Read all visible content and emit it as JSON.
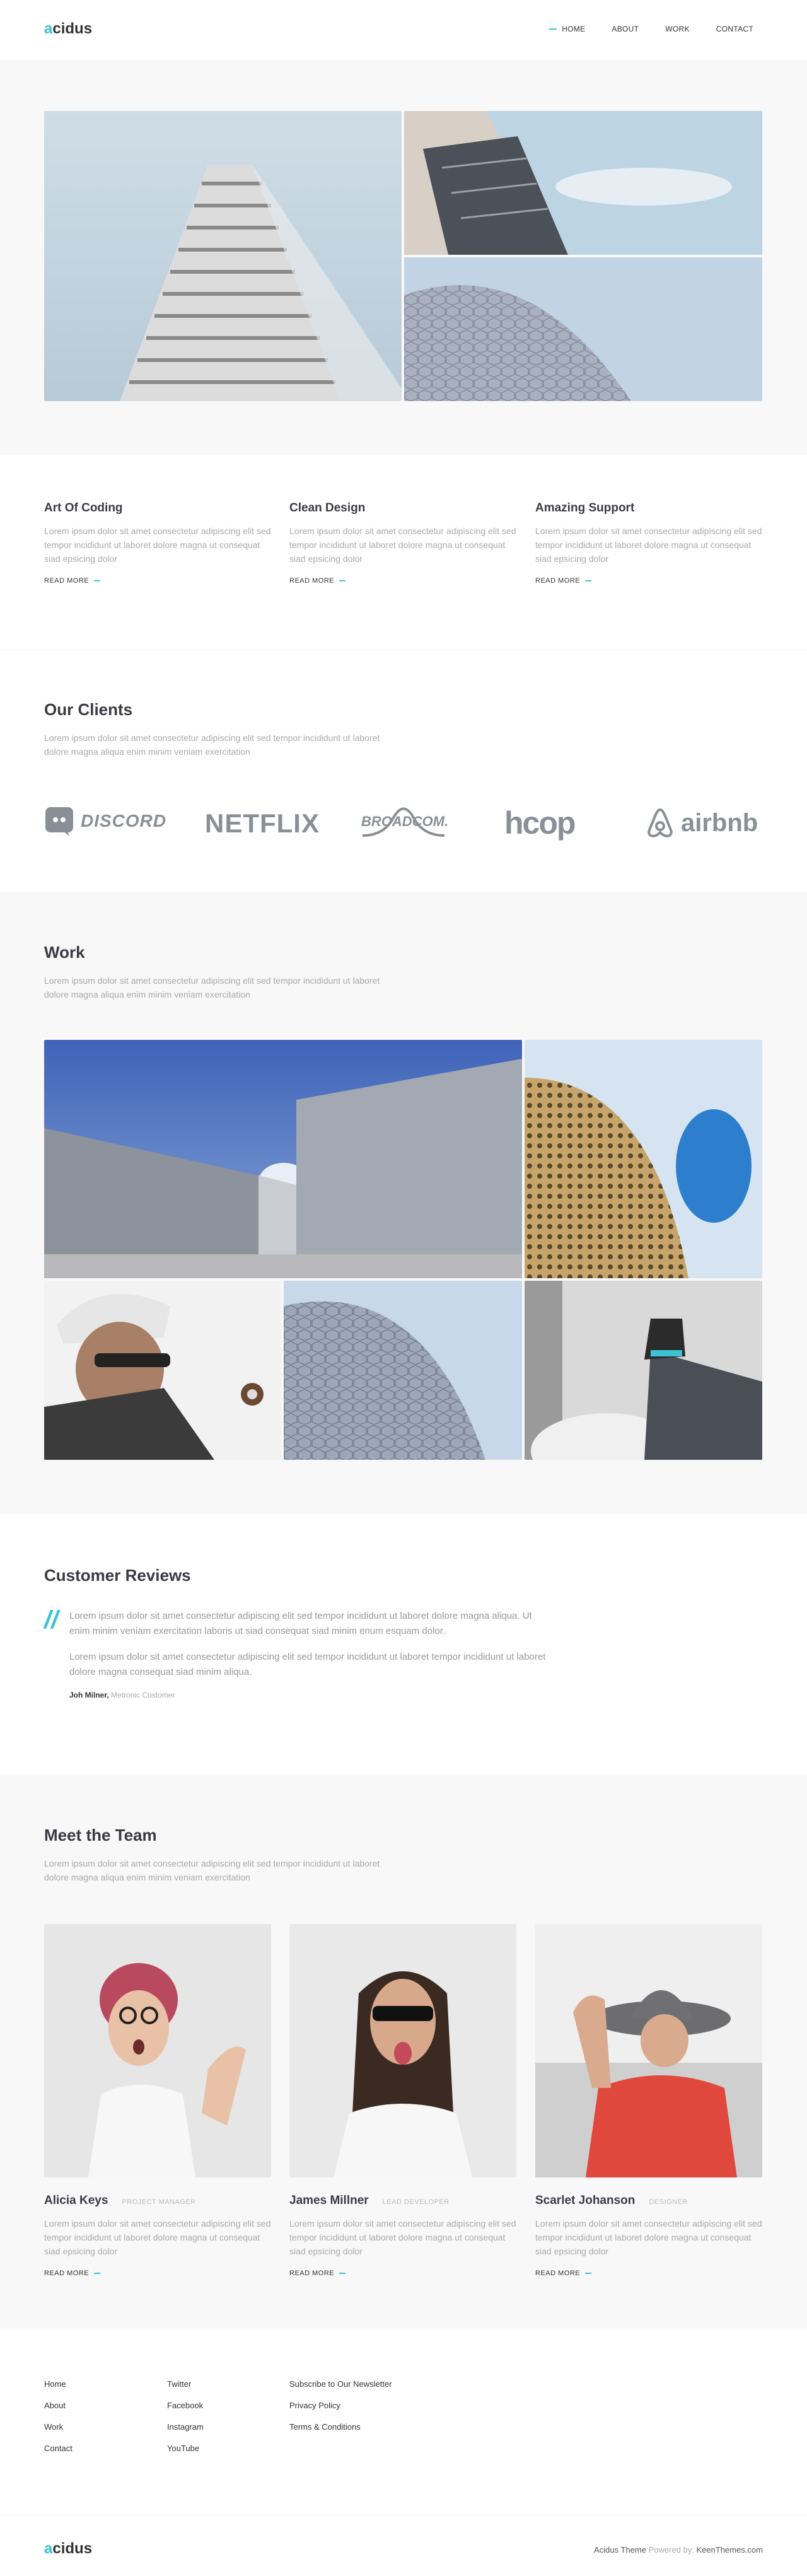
{
  "header": {
    "logo_accent": "a",
    "logo_rest": "cidus",
    "nav": [
      "HOME",
      "ABOUT",
      "WORK",
      "CONTACT"
    ]
  },
  "features": [
    {
      "title": "Art Of Coding",
      "text": "Lorem ipsum dolor sit amet consectetur adipiscing elit sed tempor incididunt ut laboret dolore magna ut consequat siad epsicing dolor",
      "link": "READ MORE"
    },
    {
      "title": "Clean Design",
      "text": "Lorem ipsum dolor sit amet consectetur adipiscing elit sed tempor incididunt ut laboret dolore magna ut consequat siad epsicing dolor",
      "link": "READ MORE"
    },
    {
      "title": "Amazing Support",
      "text": "Lorem ipsum dolor sit amet consectetur adipiscing elit sed tempor incididunt ut laboret dolore magna ut consequat siad epsicing dolor",
      "link": "READ MORE"
    }
  ],
  "clients": {
    "title": "Our Clients",
    "subtitle": "Lorem ipsum dolor sit amet consectetur adipiscing elit sed tempor incididunt ut laboret dolore magna aliqua enim minim veniam exercitation",
    "logos": [
      "DISCORD",
      "NETFLIX",
      "BROADCOM.",
      "hcop",
      "airbnb"
    ]
  },
  "work": {
    "title": "Work",
    "subtitle": "Lorem ipsum dolor sit amet consectetur adipiscing elit sed tempor incididunt ut laboret dolore magna aliqua enim minim veniam exercitation"
  },
  "reviews": {
    "title": "Customer Reviews",
    "quote1": "Lorem ipsum dolor sit amet consectetur adipiscing elit sed tempor incididunt ut laboret dolore magna aliqua. Ut enim minim veniam exercitation laboris ut siad consequat siad minim enum esquam dolor.",
    "quote2": "Lorem ipsum dolor sit amet consectetur adipiscing elit sed tempor incididunt ut laboret tempor incididunt ut laboret dolore magna consequat siad minim aliqua.",
    "author": "Joh Milner,",
    "role": "Metronic Customer"
  },
  "team": {
    "title": "Meet the Team",
    "subtitle": "Lorem ipsum dolor sit amet consectetur adipiscing elit sed tempor incididunt ut laboret dolore magna aliqua enim minim veniam exercitation",
    "members": [
      {
        "name": "Alicia Keys",
        "role": "PROJECT MANAGER",
        "text": "Lorem ipsum dolor sit amet consectetur adipiscing elit sed tempor incididunt ut laboret dolore magna ut consequat siad epsicing dolor",
        "link": "READ MORE"
      },
      {
        "name": "James Millner",
        "role": "LEAD DEVELOPER",
        "text": "Lorem ipsum dolor sit amet consectetur adipiscing elit sed tempor incididunt ut laboret dolore magna ut consequat siad epsicing dolor",
        "link": "READ MORE"
      },
      {
        "name": "Scarlet Johanson",
        "role": "DESIGNER",
        "text": "Lorem ipsum dolor sit amet consectetur adipiscing elit sed tempor incididunt ut laboret dolore magna ut consequat siad epsicing dolor",
        "link": "READ MORE"
      }
    ]
  },
  "footer": {
    "col1": [
      "Home",
      "About",
      "Work",
      "Contact"
    ],
    "col2": [
      "Twitter",
      "Facebook",
      "Instagram",
      "YouTube"
    ],
    "col3": [
      "Subscribe to Our Newsletter",
      "Privacy Policy",
      "Terms & Conditions"
    ],
    "logo_accent": "a",
    "logo_rest": "cidus",
    "credit_theme": "Acidus Theme",
    "credit_powered": "Powered by:",
    "credit_site": "KeenThemes.com"
  },
  "colors": {
    "accent": "#3cc3d3",
    "text": "#34343c",
    "muted": "#aaaaaa",
    "gray_bg": "#f8f8f8"
  }
}
